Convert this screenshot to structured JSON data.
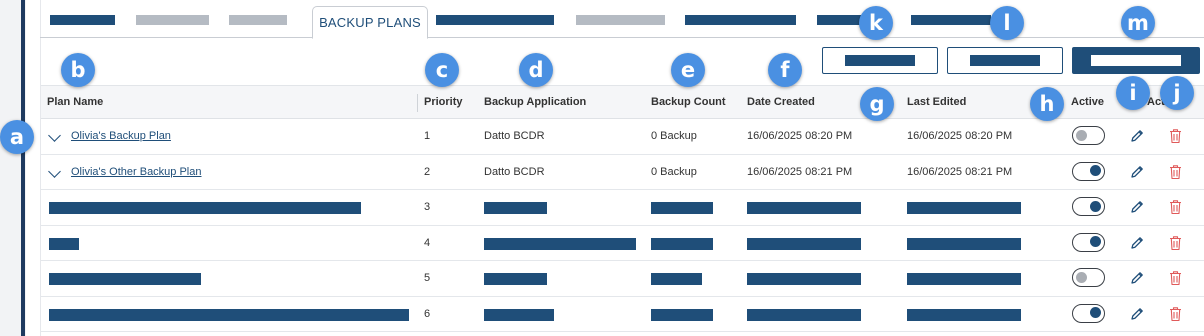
{
  "tabs": {
    "active_label": "BACKUP PLANS"
  },
  "table": {
    "headers": {
      "plan_name": "Plan Name",
      "priority": "Priority",
      "backup_application": "Backup Application",
      "backup_count": "Backup Count",
      "date_created": "Date Created",
      "last_edited": "Last Edited",
      "active": "Active",
      "actions": "Actions"
    },
    "rows": [
      {
        "plan_name": "Olivia's Backup Plan",
        "priority": "1",
        "backup_application": "Datto BCDR",
        "backup_count": "0 Backup",
        "date_created": "16/06/2025 08:20 PM",
        "last_edited": "16/06/2025 08:20 PM",
        "active": false
      },
      {
        "plan_name": "Olivia's Other Backup Plan",
        "priority": "2",
        "backup_application": "Datto BCDR",
        "backup_count": "0 Backup",
        "date_created": "16/06/2025 08:21 PM",
        "last_edited": "16/06/2025 08:21 PM",
        "active": true
      },
      {
        "priority": "3",
        "active": true
      },
      {
        "priority": "4",
        "active": true
      },
      {
        "priority": "5",
        "active": false
      },
      {
        "priority": "6",
        "active": true
      }
    ]
  },
  "badges": [
    "a",
    "b",
    "c",
    "d",
    "e",
    "f",
    "g",
    "h",
    "i",
    "j",
    "k",
    "l",
    "m"
  ],
  "colors": {
    "accent": "#1f4e79",
    "badge": "#4a90e2",
    "delete": "#e05a5a"
  }
}
